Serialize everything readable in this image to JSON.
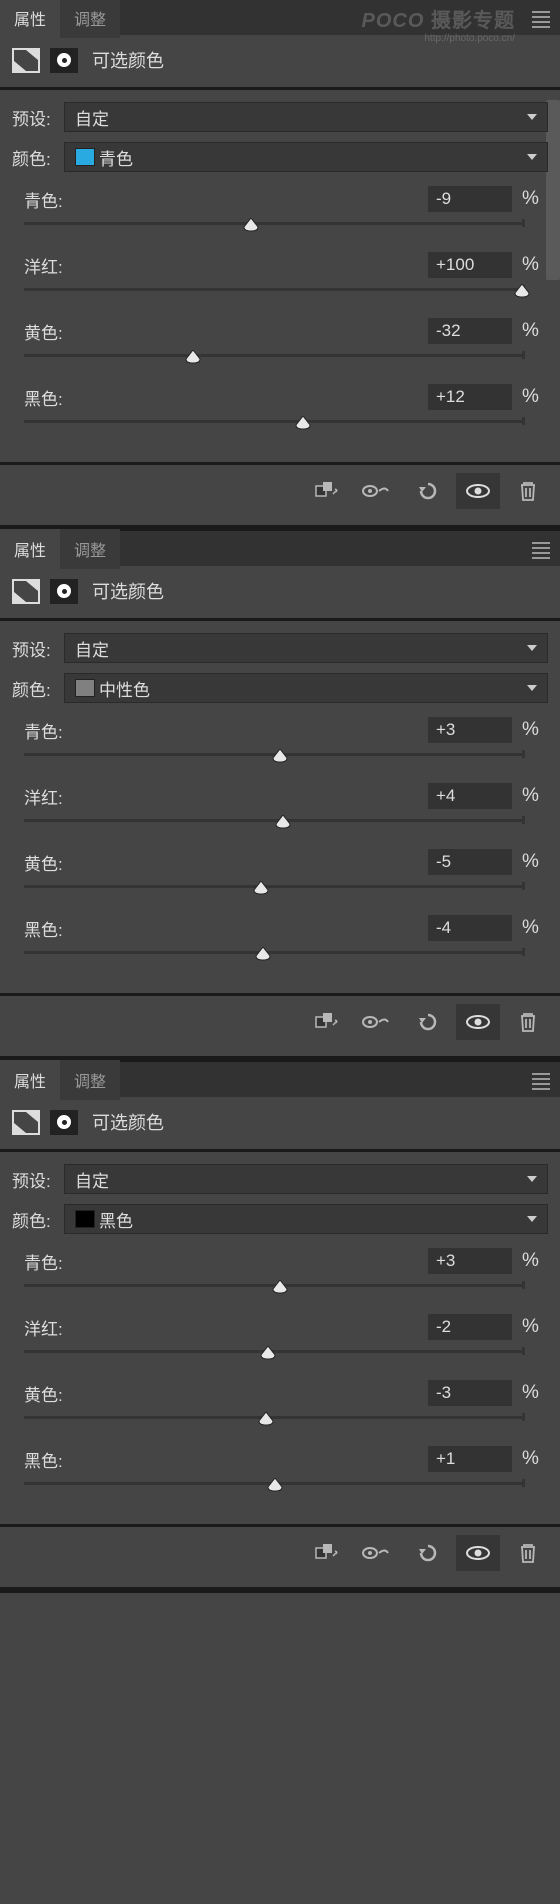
{
  "watermark": {
    "line1_logo": "POCO",
    "line1_text": " 摄影专题",
    "line2": "http://photo.poco.cn/"
  },
  "tabs": {
    "properties": "属性",
    "adjustments": "调整"
  },
  "panel_title": "可选颜色",
  "labels": {
    "preset": "预设:",
    "color": "颜色:",
    "cyan": "青色:",
    "magenta": "洋红:",
    "yellow": "黄色:",
    "black": "黑色:",
    "percent": "%"
  },
  "preset_value": "自定",
  "panels": [
    {
      "color_name": "青色",
      "swatch": "#29abe2",
      "cyan": {
        "v": "-9",
        "p": 45.5
      },
      "magenta": {
        "v": "+100",
        "p": 100
      },
      "yellow": {
        "v": "-32",
        "p": 34
      },
      "black": {
        "v": "+12",
        "p": 56
      },
      "showScroll": true,
      "showWatermark": true
    },
    {
      "color_name": "中性色",
      "swatch": "#808080",
      "cyan": {
        "v": "+3",
        "p": 51.5
      },
      "magenta": {
        "v": "+4",
        "p": 52
      },
      "yellow": {
        "v": "-5",
        "p": 47.5
      },
      "black": {
        "v": "-4",
        "p": 48
      }
    },
    {
      "color_name": "黑色",
      "swatch": "#000000",
      "cyan": {
        "v": "+3",
        "p": 51.5
      },
      "magenta": {
        "v": "-2",
        "p": 49
      },
      "yellow": {
        "v": "-3",
        "p": 48.5
      },
      "black": {
        "v": "+1",
        "p": 50.5
      }
    }
  ]
}
